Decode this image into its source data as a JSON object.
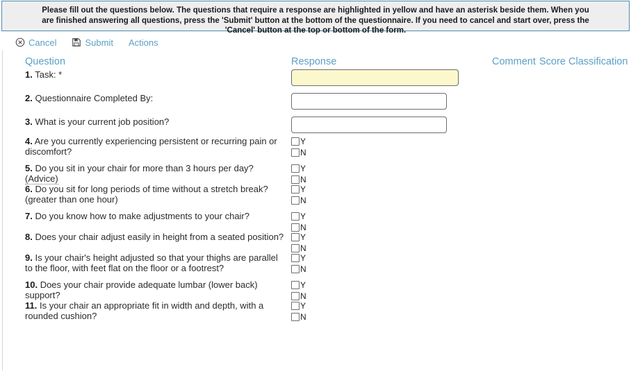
{
  "banner": {
    "text": "Please fill out the questions below. The questions that require a response are highlighted in yellow and have an asterisk beside them. When you are finished answering all questions, press the 'Submit' button at the bottom of the questionnaire. If you need to cancel and start over, press the 'Cancel' button at the top or bottom of the form.",
    "border_color": "#4d8cad",
    "background": "#eeeeee"
  },
  "toolbar": {
    "cancel_label": "Cancel",
    "submit_label": "Submit",
    "actions_label": "Actions",
    "link_color": "#5d9fc6"
  },
  "columns": {
    "question": "Question",
    "response": "Response",
    "comment": "Comment",
    "score": "Score",
    "classification": "Classification"
  },
  "options": {
    "yes": "Y",
    "no": "N"
  },
  "required_field_color": "#fbf8cd",
  "questions": [
    {
      "number": "1.",
      "text": " Task: *",
      "type": "text",
      "value": "",
      "required": true
    },
    {
      "number": "2.",
      "text": " Questionnaire Completed By:",
      "type": "text",
      "value": "",
      "required": false
    },
    {
      "number": "3.",
      "text": " What is your current job position?",
      "type": "text",
      "value": "",
      "required": false
    },
    {
      "number": "4.",
      "text": " Are you currently experiencing persistent or recurring pain or discomfort?",
      "type": "yesno",
      "required": false
    },
    {
      "number": "5.",
      "text": " Do you sit in your chair for more than 3 hours per day? ",
      "advice": "(Advice)",
      "type": "yesno",
      "required": false
    },
    {
      "number": "6.",
      "text": " Do you sit for long periods of time without a stretch break? (greater than one hour)",
      "type": "yesno",
      "required": false
    },
    {
      "number": "7.",
      "text": " Do you know how to make adjustments to your chair?",
      "type": "yesno",
      "required": false
    },
    {
      "number": "8.",
      "text": " Does your chair adjust easily in height from a seated position?",
      "type": "yesno",
      "required": false
    },
    {
      "number": "9.",
      "text": " Is your chair's height adjusted so that your thighs are parallel to the floor, with feet flat on the floor or a footrest?",
      "type": "yesno",
      "required": false
    },
    {
      "number": "10.",
      "text": " Does your chair provide adequate lumbar (lower back) support?",
      "type": "yesno",
      "required": false
    },
    {
      "number": "11.",
      "text": " Is your chair an appropriate fit in width and depth, with a rounded cushion?",
      "type": "yesno",
      "required": false
    }
  ]
}
